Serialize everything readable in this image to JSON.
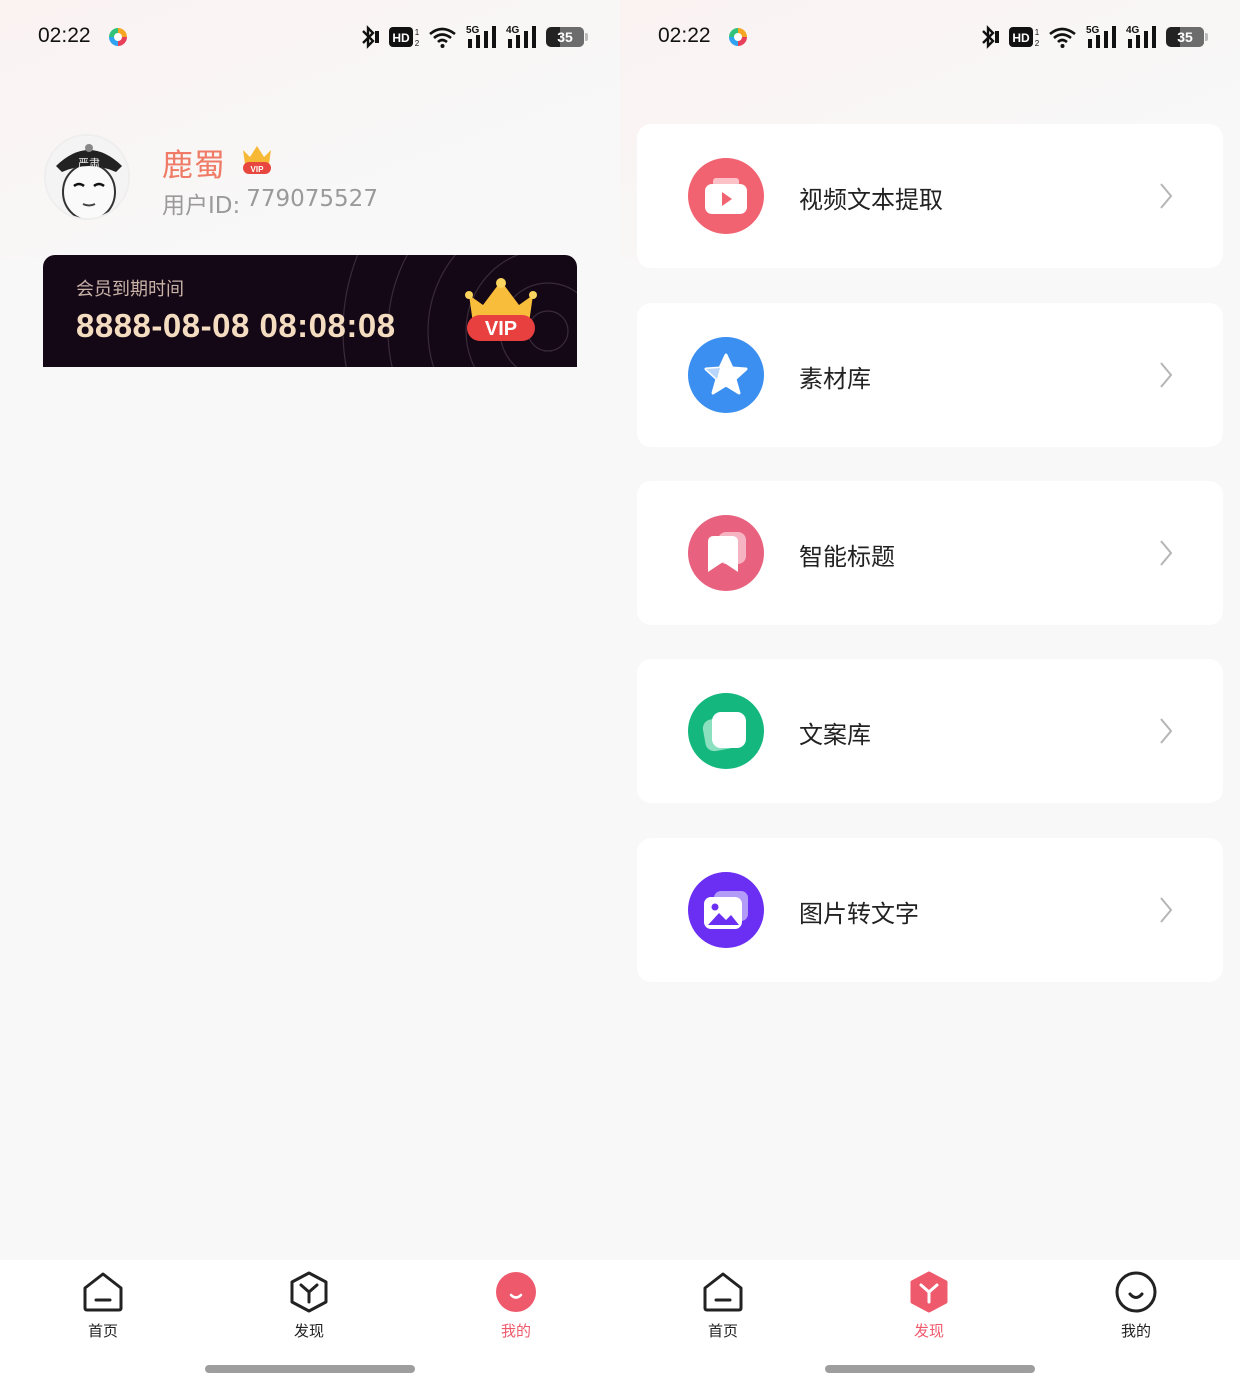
{
  "status_bar": {
    "time": "02:22",
    "hd_label": "HD",
    "net_5g": "5G",
    "net_4g": "4G",
    "battery": "35"
  },
  "profile": {
    "name": "鹿蜀",
    "user_id_label": "用户ID:",
    "user_id": "779075527",
    "avatar_caption": "严肃"
  },
  "vip_card": {
    "label": "会员到期时间",
    "expire_time": "8888-08-08 08:08:08",
    "badge_text": "VIP"
  },
  "menu": [
    {
      "label": "视频文本提取",
      "icon": "video-icon",
      "color": "#f26372"
    },
    {
      "label": "素材库",
      "icon": "star-icon",
      "color": "#3b8ff0"
    },
    {
      "label": "智能标题",
      "icon": "bookmark-icon",
      "color": "#e8627f"
    },
    {
      "label": "文案库",
      "icon": "document-icon",
      "color": "#14b87f"
    },
    {
      "label": "图片转文字",
      "icon": "image-icon",
      "color": "#6a2ff2"
    }
  ],
  "tabs": [
    {
      "label": "首页",
      "icon": "home-icon"
    },
    {
      "label": "发现",
      "icon": "discover-icon"
    },
    {
      "label": "我的",
      "icon": "profile-icon"
    }
  ],
  "colors": {
    "accent": "#ee5a6c",
    "name": "#ef7a66",
    "vip_card_bg": "#150816",
    "vip_gold": "#f4dcc1"
  },
  "active_tab_left": "我的",
  "active_tab_right": "发现"
}
